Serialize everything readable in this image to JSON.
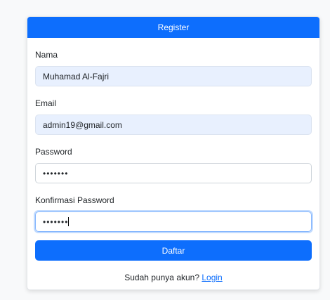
{
  "form": {
    "title": "Register",
    "fields": [
      {
        "label": "Nama",
        "value": "Muhamad Al-Fajri",
        "type": "text"
      },
      {
        "label": "Email",
        "value": "admin19@gmail.com",
        "type": "text"
      },
      {
        "label": "Password",
        "value": "•••••••",
        "type": "password"
      },
      {
        "label": "Konfirmasi Password",
        "value": "•••••••",
        "type": "password"
      }
    ],
    "submit_label": "Daftar",
    "footer_text": "Sudah punya akun?",
    "footer_link": "Login"
  },
  "colors": {
    "primary": "#0d6efd",
    "autofill_bg": "#e8f0fe",
    "page_bg": "#f8f9fa"
  }
}
